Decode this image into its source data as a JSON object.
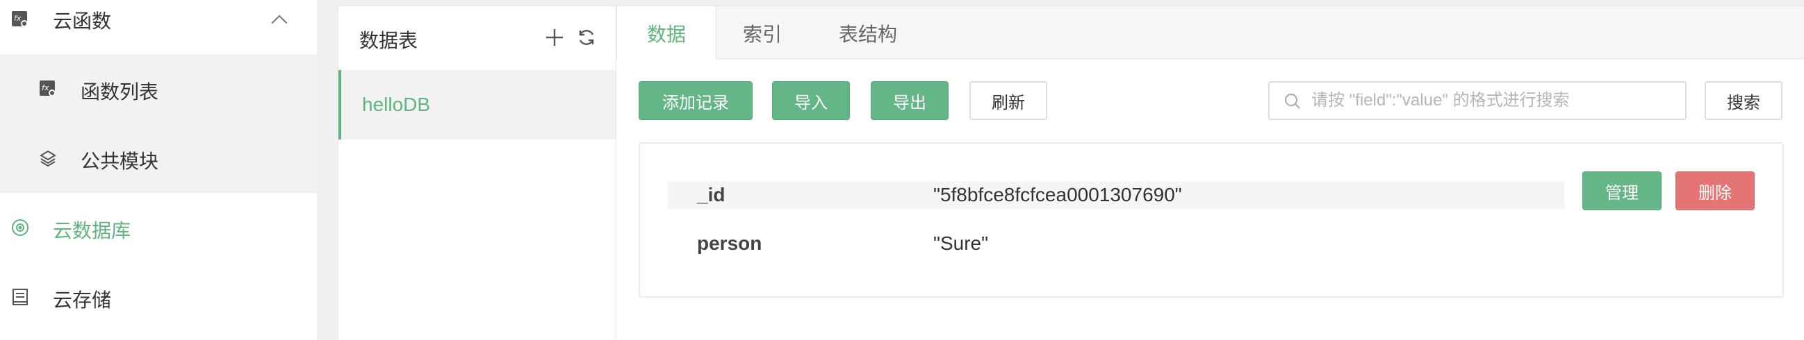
{
  "colors": {
    "accent": "#5fb47f",
    "danger": "#e57474",
    "sidebar_bg": "#ffffff",
    "sub_bg": "#f2f2f2"
  },
  "sidebar": {
    "items": [
      {
        "label": "云函数",
        "icon": "cloud-function-icon",
        "expanded": true
      },
      {
        "label": "函数列表",
        "icon": "function-list-icon"
      },
      {
        "label": "公共模块",
        "icon": "layers-icon"
      },
      {
        "label": "云数据库",
        "icon": "database-icon",
        "active": true
      },
      {
        "label": "云存储",
        "icon": "storage-icon"
      }
    ]
  },
  "tables_panel": {
    "title": "数据表",
    "add_icon": "plus-icon",
    "refresh_icon": "refresh-icon",
    "tables": [
      "helloDB"
    ]
  },
  "tabs": [
    {
      "label": "数据",
      "active": true
    },
    {
      "label": "索引"
    },
    {
      "label": "表结构"
    }
  ],
  "toolbar": {
    "add_record": "添加记录",
    "import": "导入",
    "export": "导出",
    "refresh": "刷新",
    "search_placeholder": "请按 \"field\":\"value\" 的格式进行搜索",
    "search_button": "搜索"
  },
  "record": {
    "fields": [
      {
        "key": "_id",
        "value": "\"5f8bfce8fcfcea0001307690\""
      },
      {
        "key": "person",
        "value": "\"Sure\""
      }
    ],
    "manage_label": "管理",
    "delete_label": "删除"
  }
}
